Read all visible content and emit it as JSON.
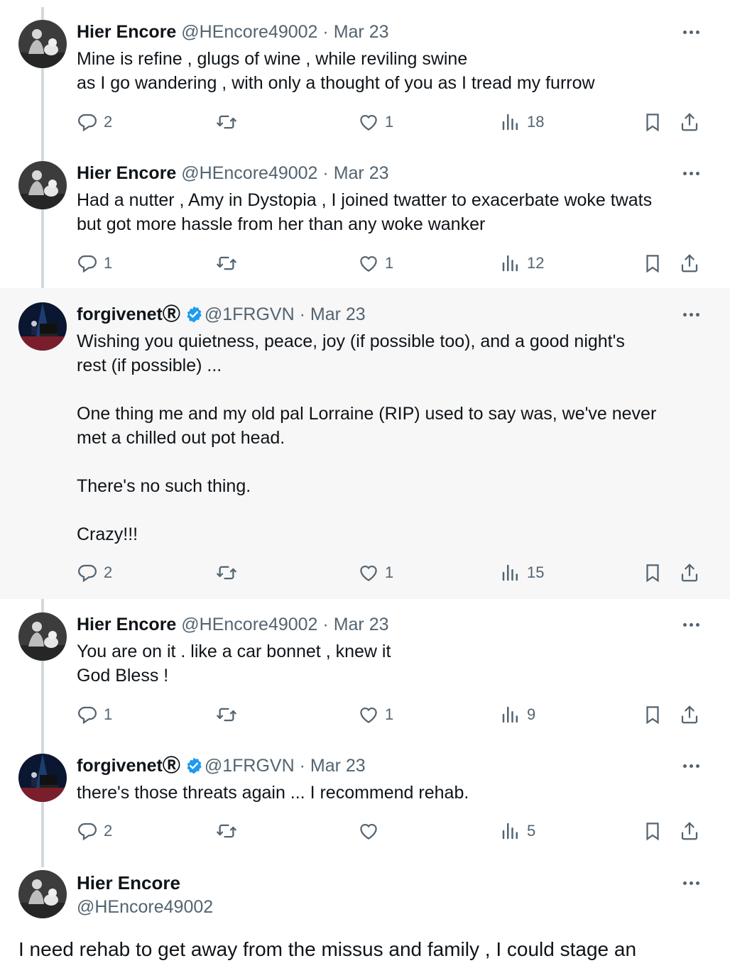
{
  "tweets": [
    {
      "author": "Hier Encore",
      "handle": "@HEncore49002",
      "sep": "·",
      "date": "Mar 23",
      "verified": false,
      "avatar": "man-with-dog",
      "lines": [
        "Mine is refine , glugs of wine , while reviling swine",
        "as I go wandering , with only a thought of you as I tread my furrow"
      ],
      "replies": "2",
      "retweets": "",
      "likes": "1",
      "views": "18"
    },
    {
      "author": "Hier Encore",
      "handle": "@HEncore49002",
      "sep": "·",
      "date": "Mar 23",
      "verified": false,
      "avatar": "man-with-dog",
      "lines": [
        "Had a nutter , Amy in Dystopia , I joined twatter to exacerbate woke twats",
        "but got more hassle from her than any woke wanker"
      ],
      "replies": "1",
      "retweets": "",
      "likes": "1",
      "views": "12"
    },
    {
      "author": "forgivenetⓇ",
      "handle": "@1FRGVN",
      "sep": "·",
      "date": "Mar 23",
      "verified": true,
      "avatar": "pianist-stage",
      "lines": [
        "Wishing you quietness, peace, joy (if possible too), and a good night's",
        "rest (if possible) ...",
        "",
        "One thing me and my old pal Lorraine (RIP) used to say was, we've never",
        "met a chilled out pot head.",
        "",
        "There's no such thing.",
        "",
        "Crazy!!!"
      ],
      "replies": "2",
      "retweets": "",
      "likes": "1",
      "views": "15"
    },
    {
      "author": "Hier Encore",
      "handle": "@HEncore49002",
      "sep": "·",
      "date": "Mar 23",
      "verified": false,
      "avatar": "man-with-dog",
      "lines": [
        "You are on it . like a car bonnet , knew it",
        "God Bless !"
      ],
      "replies": "1",
      "retweets": "",
      "likes": "1",
      "views": "9"
    },
    {
      "author": "forgivenetⓇ",
      "handle": "@1FRGVN",
      "sep": "·",
      "date": "Mar 23",
      "verified": true,
      "avatar": "pianist-stage",
      "lines": [
        "there's those threats again ... I recommend rehab."
      ],
      "replies": "2",
      "retweets": "",
      "likes": "",
      "views": "5"
    }
  ],
  "main_tweet": {
    "author": "Hier Encore",
    "handle": "@HEncore49002",
    "avatar": "man-with-dog",
    "text": "I need rehab to get away from the missus and family , I could stage an"
  },
  "colors": {
    "text": "#0f1419",
    "muted": "#536471",
    "verified": "#1d9bf0",
    "highlight_bg": "#f7f7f7",
    "thread_line": "#cfd9de"
  },
  "icons": [
    "reply-icon",
    "retweet-icon",
    "like-icon",
    "views-icon",
    "bookmark-icon",
    "share-icon",
    "more-icon",
    "verified-badge-icon"
  ]
}
